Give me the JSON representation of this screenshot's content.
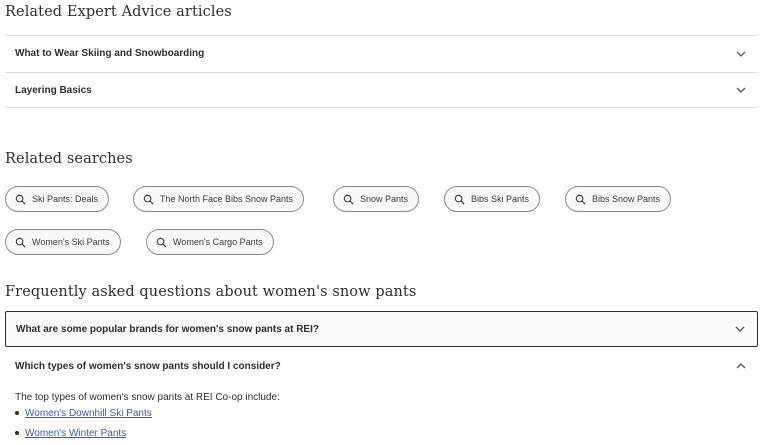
{
  "related_articles": {
    "title": "Related Expert Advice articles",
    "items": [
      {
        "label": "What to Wear Skiing and Snowboarding"
      },
      {
        "label": "Layering Basics"
      }
    ]
  },
  "related_searches": {
    "title": "Related searches",
    "chips": [
      "Ski Pants: Deals",
      "The North Face Bibs Snow Pants",
      "Snow Pants",
      "Bibs Ski Pants",
      "Bibs Snow Pants",
      "Women's Ski Pants",
      "Women's Cargo Pants"
    ]
  },
  "faq": {
    "title": "Frequently asked questions about women's snow pants",
    "items": [
      {
        "question": "What are some popular brands for women's snow pants at REI?",
        "expanded": false
      },
      {
        "question": "Which types of women's snow pants should I consider?",
        "expanded": true
      }
    ],
    "answer": {
      "intro": "The top types of women's snow pants at REI Co-op include:",
      "links": [
        "Women's Downhill Ski Pants",
        "Women's Winter Pants"
      ]
    }
  },
  "icons": {
    "chip": "search-icon",
    "collapsed": "chevron-down-icon",
    "expanded": "chevron-up-icon"
  },
  "colors": {
    "text": "#2e2e2b",
    "link": "#2f5cbb",
    "divider": "#dcdcd6"
  }
}
